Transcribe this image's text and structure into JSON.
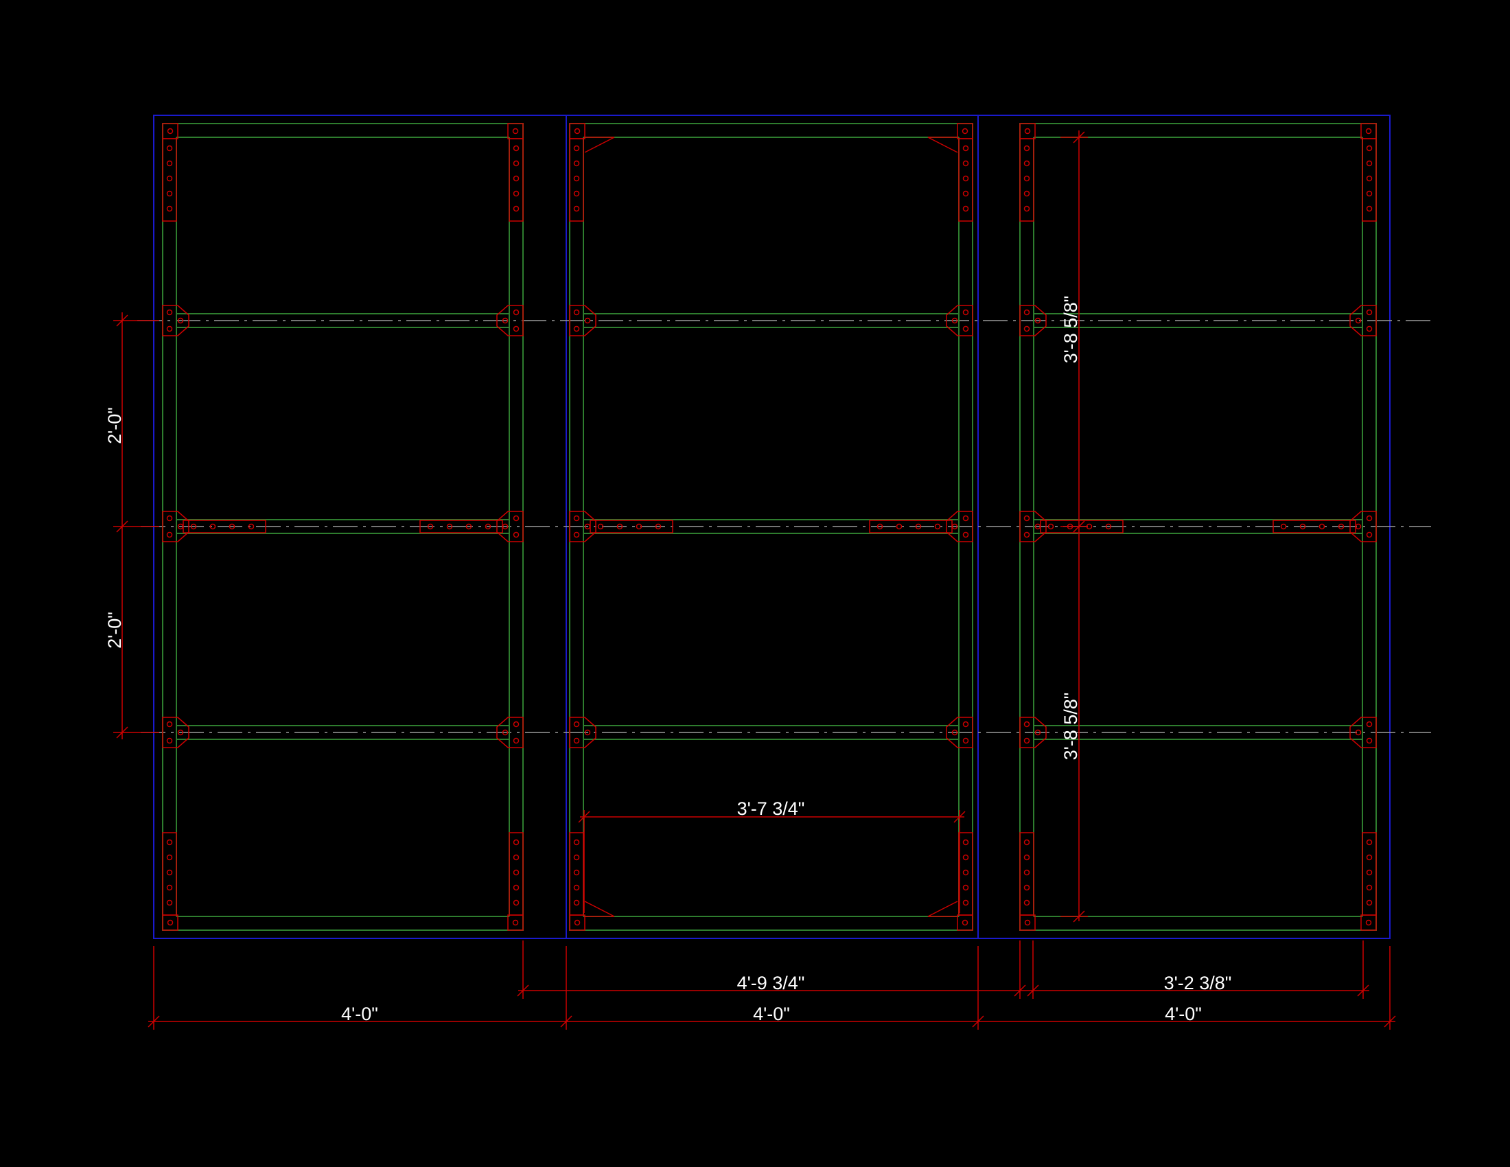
{
  "drawing": {
    "colors": {
      "background": "#000000",
      "frame": "#2e7d2e",
      "bracket": "#cc0000",
      "dimension": "#cc0000",
      "panel_boundary": "#1a1acc",
      "centerline": "#9a9a9a",
      "text": "#ffffff"
    },
    "dimensions": {
      "row_spacing_upper": "2'-0\"",
      "row_spacing_lower": "2'-0\"",
      "right_height_upper": "3'-8 5/8\"",
      "right_height_lower": "3'-8 5/8\"",
      "inner_middle_width": "3'-7 3/4\"",
      "middle_overall": "4'-9 3/4\"",
      "right_inner": "3'-2 3/8\"",
      "panel_left": "4'-0\"",
      "panel_middle": "4'-0\"",
      "panel_right": "4'-0\""
    }
  }
}
